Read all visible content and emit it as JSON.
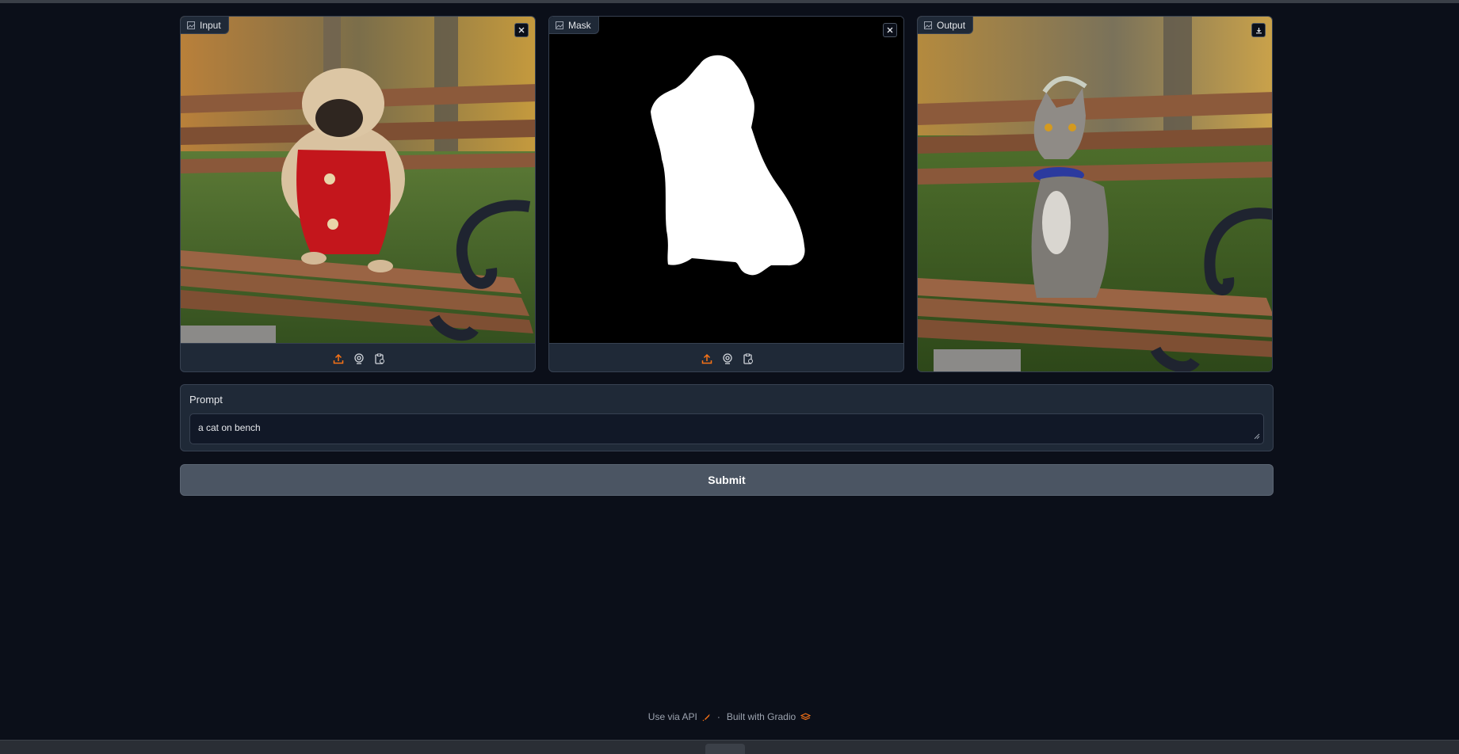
{
  "panels": {
    "input": {
      "label": "Input",
      "clear_icon": "close-icon"
    },
    "mask": {
      "label": "Mask",
      "clear_icon": "close-icon"
    },
    "output": {
      "label": "Output",
      "download_icon": "download-icon"
    }
  },
  "toolbar_icons": [
    "upload-icon",
    "webcam-icon",
    "clipboard-icon"
  ],
  "prompt": {
    "label": "Prompt",
    "value": "a cat on bench"
  },
  "submit": {
    "label": "Submit"
  },
  "footer": {
    "api_label": "Use via API",
    "separator": "·",
    "built_with": "Built with Gradio"
  },
  "colors": {
    "background": "#0b0f19",
    "panel": "#1f2937",
    "accent": "#f97316",
    "submit": "#4b5563"
  }
}
